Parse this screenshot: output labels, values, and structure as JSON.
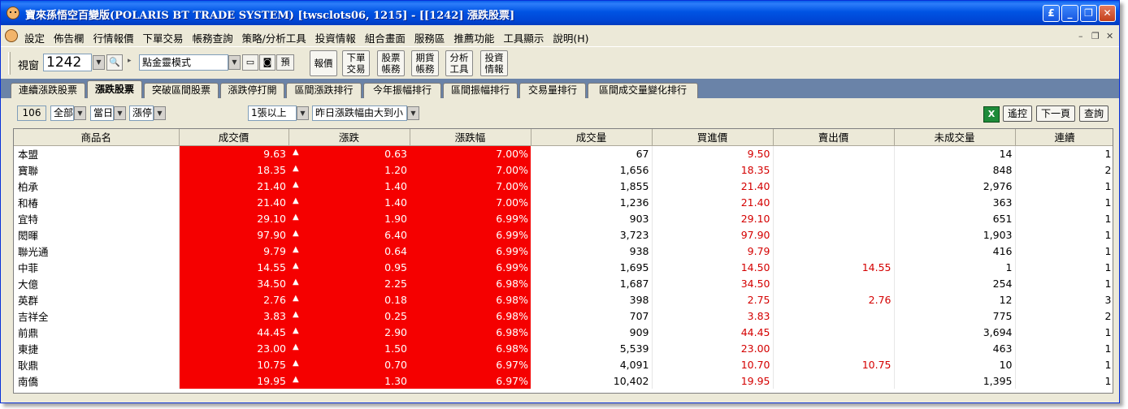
{
  "window": {
    "title": "寶來孫悟空百變版(POLARIS BT TRADE SYSTEM)  [twsclots06, 1215] - [[1242] 漲跌股票]"
  },
  "menu": {
    "items": [
      "設定",
      "佈告欄",
      "行情報價",
      "下單交易",
      "帳務查詢",
      "策略/分析工具",
      "投資情報",
      "組合畫面",
      "服務區",
      "推薦功能",
      "工具顯示",
      "說明(H)"
    ]
  },
  "toolbar": {
    "window_label": "視窗",
    "window_number": "1242",
    "mode": "點金靈模式",
    "pre_label": "預",
    "btn_quote": "報價",
    "btn_order": [
      "下單",
      "交易"
    ],
    "btn_stock_account": [
      "股票",
      "帳務"
    ],
    "btn_futures_account": [
      "期貨",
      "帳務"
    ],
    "btn_analysis": [
      "分析",
      "工具"
    ],
    "btn_info": [
      "投資",
      "情報"
    ]
  },
  "tabs": [
    "連續漲跌股票",
    "漲跌股票",
    "突破區間股票",
    "漲跌停打開",
    "區間漲跌排行",
    "今年振幅排行",
    "區間振幅排行",
    "交易量排行",
    "區間成交量變化排行"
  ],
  "active_tab": 1,
  "filters": {
    "count": "106",
    "market": "全部",
    "period": "當日",
    "type": "漲停",
    "volume": "1張以上",
    "sort": "昨日漲跌幅由大到小"
  },
  "buttons": {
    "excel": "X",
    "remote": "遙控",
    "next_page": "下一頁",
    "query": "查詢"
  },
  "table": {
    "columns": [
      "商品名",
      "成交價",
      "漲跌",
      "漲跌幅",
      "成交量",
      "買進價",
      "賣出價",
      "未成交量",
      "連續"
    ],
    "rows": [
      {
        "name": "本盟",
        "price": "9.63",
        "change": "0.63",
        "pct": "7.00%",
        "volume": "67",
        "bid": "9.50",
        "ask": "",
        "unfilled": "14",
        "streak": "1"
      },
      {
        "name": "寶聯",
        "price": "18.35",
        "change": "1.20",
        "pct": "7.00%",
        "volume": "1,656",
        "bid": "18.35",
        "ask": "",
        "unfilled": "848",
        "streak": "2"
      },
      {
        "name": "柏承",
        "price": "21.40",
        "change": "1.40",
        "pct": "7.00%",
        "volume": "1,855",
        "bid": "21.40",
        "ask": "",
        "unfilled": "2,976",
        "streak": "1"
      },
      {
        "name": "和椿",
        "price": "21.40",
        "change": "1.40",
        "pct": "7.00%",
        "volume": "1,236",
        "bid": "21.40",
        "ask": "",
        "unfilled": "363",
        "streak": "1"
      },
      {
        "name": "宜特",
        "price": "29.10",
        "change": "1.90",
        "pct": "6.99%",
        "volume": "903",
        "bid": "29.10",
        "ask": "",
        "unfilled": "651",
        "streak": "1"
      },
      {
        "name": "閎暉",
        "price": "97.90",
        "change": "6.40",
        "pct": "6.99%",
        "volume": "3,723",
        "bid": "97.90",
        "ask": "",
        "unfilled": "1,903",
        "streak": "1"
      },
      {
        "name": "聯光通",
        "price": "9.79",
        "change": "0.64",
        "pct": "6.99%",
        "volume": "938",
        "bid": "9.79",
        "ask": "",
        "unfilled": "416",
        "streak": "1"
      },
      {
        "name": "中菲",
        "price": "14.55",
        "change": "0.95",
        "pct": "6.99%",
        "volume": "1,695",
        "bid": "14.50",
        "ask": "14.55",
        "unfilled": "1",
        "streak": "1"
      },
      {
        "name": "大億",
        "price": "34.50",
        "change": "2.25",
        "pct": "6.98%",
        "volume": "1,687",
        "bid": "34.50",
        "ask": "",
        "unfilled": "254",
        "streak": "1"
      },
      {
        "name": "英群",
        "price": "2.76",
        "change": "0.18",
        "pct": "6.98%",
        "volume": "398",
        "bid": "2.75",
        "ask": "2.76",
        "unfilled": "12",
        "streak": "3"
      },
      {
        "name": "吉祥全",
        "price": "3.83",
        "change": "0.25",
        "pct": "6.98%",
        "volume": "707",
        "bid": "3.83",
        "ask": "",
        "unfilled": "775",
        "streak": "2"
      },
      {
        "name": "前鼎",
        "price": "44.45",
        "change": "2.90",
        "pct": "6.98%",
        "volume": "909",
        "bid": "44.45",
        "ask": "",
        "unfilled": "3,694",
        "streak": "1"
      },
      {
        "name": "東捷",
        "price": "23.00",
        "change": "1.50",
        "pct": "6.98%",
        "volume": "5,539",
        "bid": "23.00",
        "ask": "",
        "unfilled": "463",
        "streak": "1"
      },
      {
        "name": "耿鼎",
        "price": "10.75",
        "change": "0.70",
        "pct": "6.97%",
        "volume": "4,091",
        "bid": "10.70",
        "ask": "10.75",
        "unfilled": "10",
        "streak": "1"
      },
      {
        "name": "南僑",
        "price": "19.95",
        "change": "1.30",
        "pct": "6.97%",
        "volume": "10,402",
        "bid": "19.95",
        "ask": "",
        "unfilled": "1,395",
        "streak": "1"
      }
    ]
  },
  "colors": {
    "limit_up_bg": "#f50000",
    "price_red": "#d40000",
    "title_blue": "#0054e3",
    "tab_strip": "#6a83a8"
  }
}
